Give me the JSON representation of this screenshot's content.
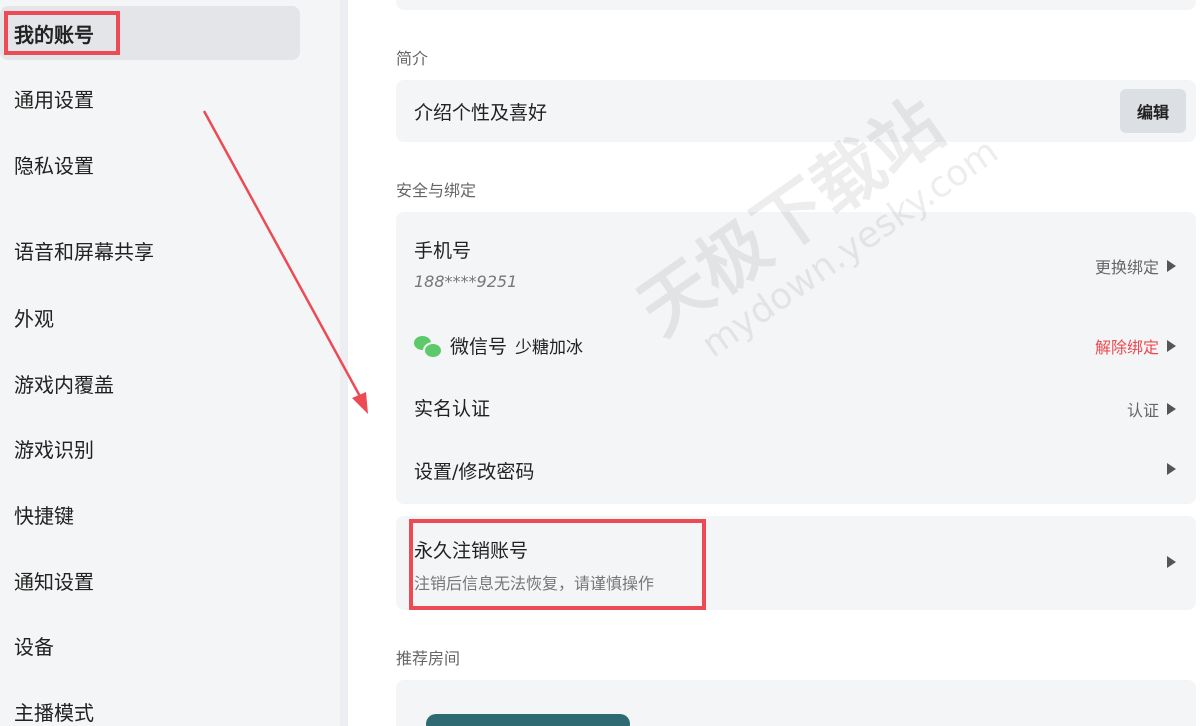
{
  "sidebar": {
    "items": [
      {
        "label": "我的账号"
      },
      {
        "label": "通用设置"
      },
      {
        "label": "隐私设置"
      },
      {
        "label": "语音和屏幕共享"
      },
      {
        "label": "外观"
      },
      {
        "label": "游戏内覆盖"
      },
      {
        "label": "游戏识别"
      },
      {
        "label": "快捷键"
      },
      {
        "label": "通知设置"
      },
      {
        "label": "设备"
      },
      {
        "label": "主播模式"
      }
    ]
  },
  "intro": {
    "section_label": "简介",
    "placeholder": "介绍个性及喜好",
    "edit_label": "编辑"
  },
  "security": {
    "section_label": "安全与绑定",
    "phone": {
      "title": "手机号",
      "value": "188****9251",
      "action": "更换绑定"
    },
    "wechat": {
      "title": "微信号",
      "value": "少糖加冰",
      "action": "解除绑定"
    },
    "realname": {
      "title": "实名认证",
      "action": "认证"
    },
    "password": {
      "title": "设置/修改密码"
    }
  },
  "delete_account": {
    "title": "永久注销账号",
    "subtitle": "注销后信息无法恢复，请谨慎操作"
  },
  "recommend": {
    "section_label": "推荐房间"
  },
  "watermark": {
    "line1": "天极下载站",
    "line2": "mydown.yesky.com"
  },
  "colors": {
    "accent_red": "#ec4b55",
    "danger_text": "#ea4a4f",
    "wechat_green": "#5ec96b",
    "sidebar_bg": "#f4f5f7",
    "card_bg": "#f4f5f7"
  }
}
